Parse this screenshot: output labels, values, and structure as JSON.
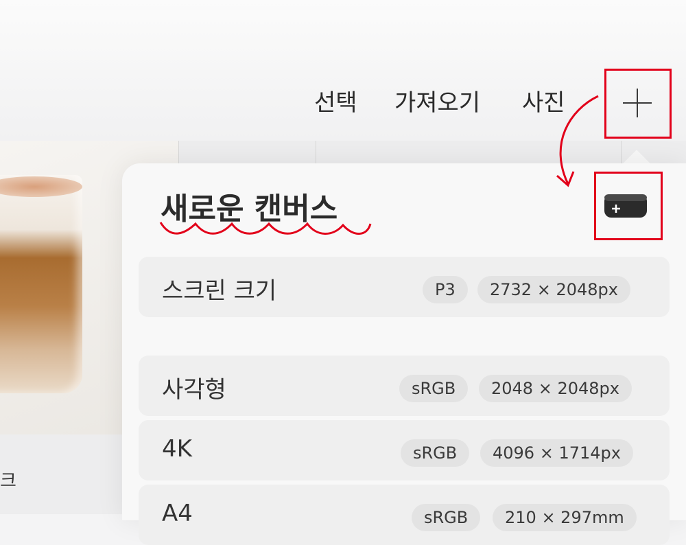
{
  "toolbar": {
    "select_label": "선택",
    "import_label": "가져오기",
    "photo_label": "사진",
    "add_icon": "plus-icon"
  },
  "gallery": {
    "thumbnail_label": "크"
  },
  "popover": {
    "title": "새로운 캔버스",
    "new_canvas_icon": "custom-canvas-icon",
    "rows": [
      {
        "label": "스크린 크기",
        "color_profile": "P3",
        "size": "2732 × 2048px"
      },
      {
        "label": "사각형",
        "color_profile": "sRGB",
        "size": "2048 × 2048px"
      },
      {
        "label": "4K",
        "color_profile": "sRGB",
        "size": "4096 × 1714px"
      },
      {
        "label": "A4",
        "color_profile": "sRGB",
        "size": "210 × 297mm"
      }
    ]
  },
  "annotation": {
    "color": "#e2001a"
  }
}
